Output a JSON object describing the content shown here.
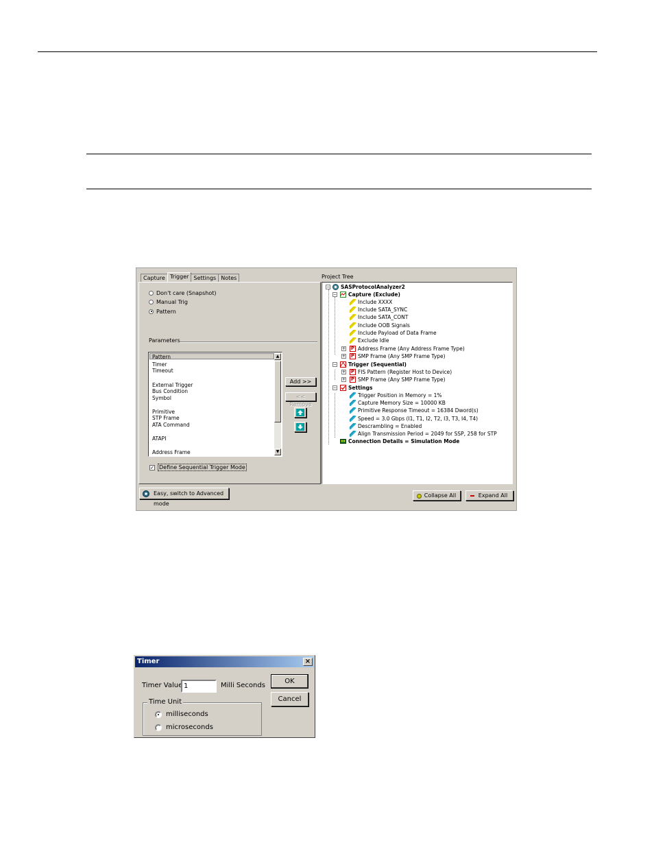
{
  "main_window": {
    "tabs": [
      "Capture",
      "Trigger",
      "Settings",
      "Notes"
    ],
    "active_tab": "Trigger",
    "trigger_options": [
      {
        "label": "Don't care (Snapshot)",
        "selected": false
      },
      {
        "label": "Manual Trig",
        "selected": false
      },
      {
        "label": "Pattern",
        "selected": true
      }
    ],
    "parameters_label": "Parameters",
    "pattern_list": {
      "header": "Pattern",
      "items": [
        "Timer",
        "Timeout",
        "External Trigger",
        "Bus Condition",
        "Symbol",
        "Primitive",
        "STP Frame",
        "ATA Command",
        "ATAPI",
        "Address Frame"
      ]
    },
    "add_button": "Add >>",
    "remove_button": "<< Remove",
    "sequential_checkbox": {
      "label": "Define Sequential Trigger Mode",
      "checked": true
    },
    "mode_button": "Easy, switch to Advanced mode",
    "project_tree_label": "Project Tree",
    "tree": {
      "root": "SASProtocolAnalyzer2",
      "capture": {
        "label": "Capture (Exclude)",
        "children": [
          "Include XXXX",
          "Include SATA_SYNC",
          "Include SATA_CONT",
          "Include OOB Signals",
          "Include Payload of Data Frame",
          "Exclude Idle",
          "Address Frame (Any Address Frame Type)",
          "SMP Frame (Any SMP Frame Type)"
        ]
      },
      "trigger": {
        "label": "Trigger (Sequential)",
        "children": [
          "FIS Pattern (Register Host to Device)",
          "SMP Frame (Any SMP Frame Type)"
        ]
      },
      "settings": {
        "label": "Settings",
        "children": [
          "Trigger Position in Memory = 1%",
          "Capture Memory Size = 10000 KB",
          "Primitive Response Timeout = 16384 Dword(s)",
          "Speed = 3.0 Gbps (I1, T1, I2, T2, I3, T3, I4, T4)",
          "Descrambling = Enabled",
          "Align Transmission Period = 2049 for SSP, 258 for STP"
        ]
      },
      "connection": "Connection Details = Simulation Mode"
    },
    "collapse_button": "Collapse All",
    "expand_button": "Expand All"
  },
  "timer_dialog": {
    "title": "Timer",
    "value_label": "Timer Value:",
    "value": "1",
    "unit_suffix": "Milli Seconds",
    "ok": "OK",
    "cancel": "Cancel",
    "group_title": "Time Unit",
    "units": [
      {
        "label": "milliseconds",
        "selected": true
      },
      {
        "label": "microseconds",
        "selected": false
      }
    ]
  },
  "colors": {
    "title_bar_start": "#0a246a",
    "title_bar_end": "#a6caf0",
    "dialog_bg": "#d4d0c8"
  }
}
